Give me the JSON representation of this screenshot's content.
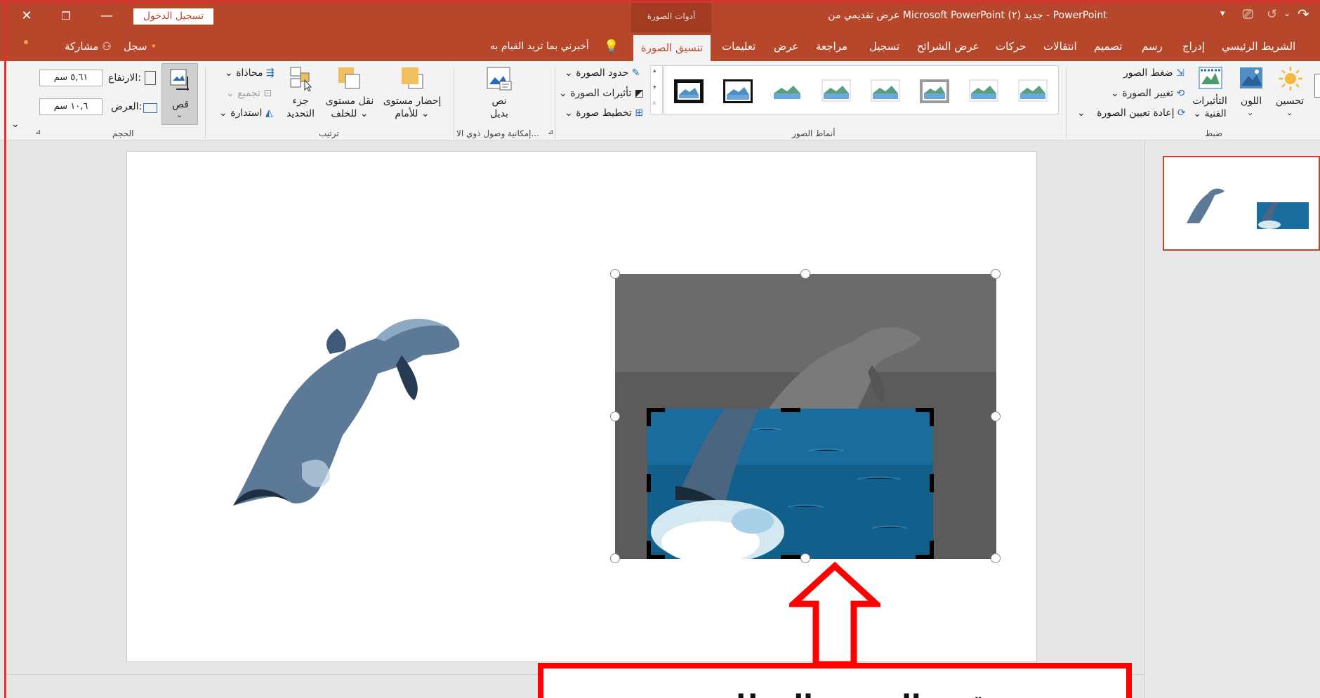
{
  "titlebar": {
    "title": "عرض تقديمي من Microsoft PowerPoint جديد (٢)  -  PowerPoint",
    "context_tab": "أدوات الصورة",
    "signin": "تسجيل الدخول"
  },
  "tabs": {
    "home": "الشريط الرئيسي",
    "insert": "إدراج",
    "draw": "رسم",
    "design": "تصميم",
    "transitions": "انتقالات",
    "animations": "حركات",
    "slideshow": "عرض الشرائح",
    "record": "تسجيل",
    "review": "مراجعة",
    "view": "عرض",
    "help": "تعليمات",
    "format": "تنسيق الصورة",
    "tellme": "أخبرني بما تريد القيام به",
    "share": "مشاركة",
    "record_btn": "سجل"
  },
  "ribbon": {
    "adjust": {
      "group": "ضبط",
      "corrections": "تحسين",
      "color": "اللون",
      "artistic": "التأثيرات",
      "artistic2": "الفنية",
      "compress": "ضغط الصور",
      "change": "تغيير الصورة",
      "reset": "إعادة تعيين الصورة"
    },
    "styles": {
      "group": "أنماط الصور",
      "border": "حدود الصورة",
      "effects": "تأثيرات الصورة",
      "layout": "تخطيط صورة"
    },
    "accessibility": {
      "group": "إمكانية وصول ذوي الا...",
      "alt_text": "نص",
      "alt_text2": "بديل"
    },
    "arrange": {
      "group": "ترتيب",
      "bring_forward": "إحضار مستوى",
      "bring_forward2": "للأمام",
      "send_backward": "نقل مستوى",
      "send_backward2": "للخلف",
      "selection": "جزء",
      "selection2": "التحديد",
      "align": "محاذاة",
      "group_btn": "تجميع",
      "rotate": "استدارة"
    },
    "size": {
      "group": "الحجم",
      "crop": "قص",
      "height_label": "الارتفاع:",
      "height_value": "٥,٦١ سم",
      "width_label": "العرض:",
      "width_value": "١٠,٦ سم"
    }
  },
  "callout": {
    "text": "قص الصورة المطلوب"
  },
  "colors": {
    "accent": "#b7472a",
    "callout": "#ff0000"
  }
}
